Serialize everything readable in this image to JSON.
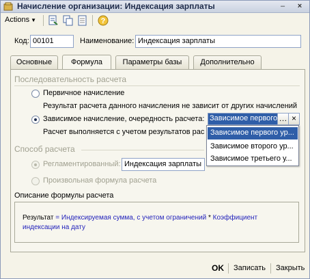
{
  "window": {
    "title": "Начисление организации: Индексация зарплаты",
    "min_glyph": "–",
    "close_glyph": "×"
  },
  "toolbar": {
    "actions_label": "Actions",
    "actions_caret": "▼"
  },
  "form": {
    "code_label": "Код:",
    "code_value": "00101",
    "name_label": "Наименование:",
    "name_value": "Индексация зарплаты"
  },
  "tabs": [
    {
      "label": "Основные"
    },
    {
      "label": "Формула",
      "active": true
    },
    {
      "label": "Параметры базы"
    },
    {
      "label": "Дополнительно"
    }
  ],
  "sequence": {
    "title": "Последовательность расчета",
    "primary_label": "Первичное начисление",
    "primary_note": "Результат расчета данного начисления не зависит от других начислений",
    "dependent_label": "Зависимое начисление, очередность расчета:",
    "dependent_note": "Расчет выполняется с учетом результатов рас",
    "combo_value": "Зависимое первого",
    "combo_select_glyph": "…",
    "combo_clear_glyph": "×",
    "options": [
      "Зависимое первого ур...",
      "Зависимое второго ур...",
      "Зависимое третьего у..."
    ]
  },
  "method": {
    "title": "Способ расчета",
    "regulated_label": "Регламентированный:",
    "regulated_value": "Индексация зарплаты",
    "arbitrary_label": "Произвольная формула расчета"
  },
  "description": {
    "title": "Описание формулы расчета",
    "result_word": "Результат",
    "eq": " = ",
    "part1": "Индексируемая сумма, с учетом ограничений",
    "star": " * ",
    "part2": "Коэффициент индексации на дату"
  },
  "footer": {
    "ok": "OK",
    "save": "Записать",
    "close": "Закрыть"
  },
  "colors": {
    "accent": "#2F5EA8",
    "formula_blue": "#2222BB",
    "disabled_gray": "#A0A090"
  }
}
